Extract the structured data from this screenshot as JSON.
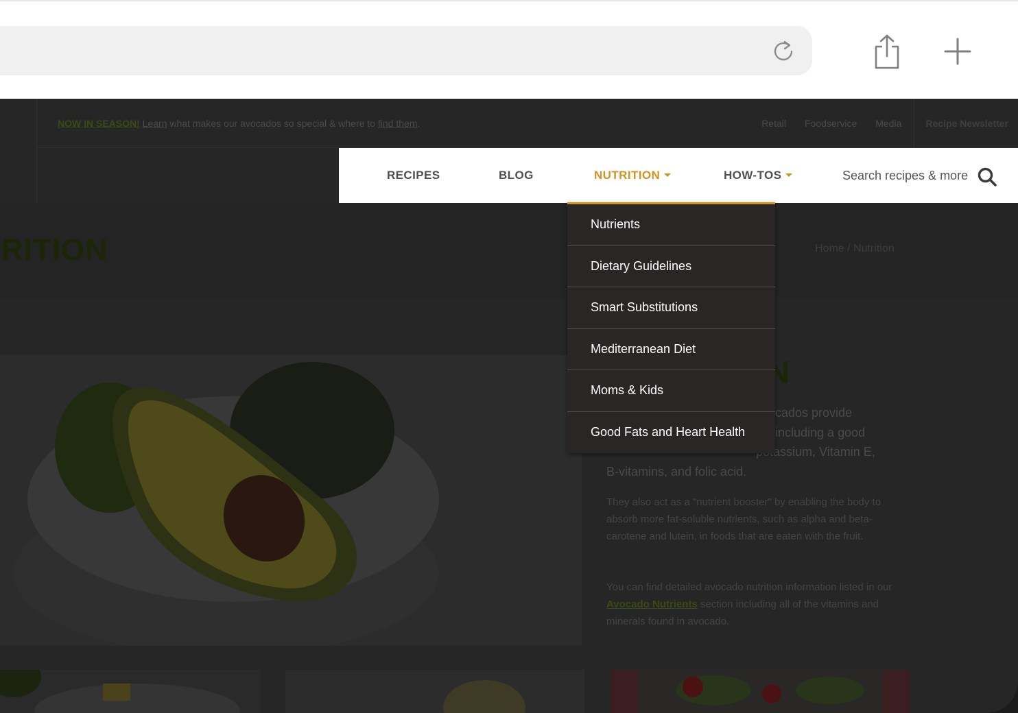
{
  "top_notice": {
    "highlight": "NOW IN SEASON!",
    "learn": "Learn",
    "middle": " what makes our avocados so special & where to ",
    "find": "find them",
    "end": "."
  },
  "top_links": [
    "Retail",
    "Foodservice",
    "Media"
  ],
  "newsletter": "Recipe Newsletter",
  "nav": {
    "recipes": "RECIPES",
    "blog": "BLOG",
    "nutrition": "NUTRITION",
    "howtos": "HOW-TOS",
    "search_placeholder": "Search recipes & more"
  },
  "page_title": "TRITION",
  "breadcrumb": {
    "home": "Home /",
    "current": "Nutrition"
  },
  "content": {
    "heading_partial": "N",
    "lead_lines": [
      "cados provide",
      " including a good",
      "potassium, Vitamin E,",
      "B-vitamins, and folic acid."
    ],
    "para1": "They also act as a \"nutrient booster\" by enabling the body to absorb more fat-soluble nutrients, such as alpha and beta-carotene and lutein, in foods that are eaten with the fruit.",
    "para2_before": "You can find detailed avocado nutrition information listed in our ",
    "para2_link": "Avocado Nutrients",
    "para2_after": " section including all of the vitamins and minerals found in avocado."
  },
  "dropdown": [
    "Nutrients",
    "Dietary Guidelines",
    "Smart Substitutions",
    "Mediterranean Diet",
    "Moms & Kids",
    "Good Fats and Heart Health"
  ],
  "colors": {
    "accent": "#d4921e",
    "dark_green": "#3b4a14",
    "dropdown_bg": "#2a2626"
  }
}
